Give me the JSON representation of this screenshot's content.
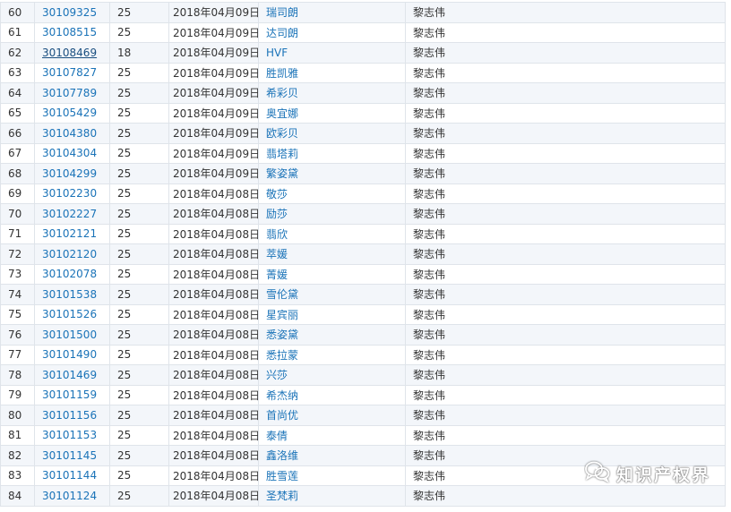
{
  "rows": [
    {
      "no": "60",
      "reg": "30109325",
      "cls": "25",
      "date": "2018年04月09日",
      "mark": "瑞司朗",
      "owner": "黎志伟"
    },
    {
      "no": "61",
      "reg": "30108515",
      "cls": "25",
      "date": "2018年04月09日",
      "mark": "达司朗",
      "owner": "黎志伟"
    },
    {
      "no": "62",
      "reg": "30108469",
      "cls": "18",
      "date": "2018年04月09日",
      "mark": "HVF",
      "owner": "黎志伟"
    },
    {
      "no": "63",
      "reg": "30107827",
      "cls": "25",
      "date": "2018年04月09日",
      "mark": "胜凯雅",
      "owner": "黎志伟"
    },
    {
      "no": "64",
      "reg": "30107789",
      "cls": "25",
      "date": "2018年04月09日",
      "mark": "希彩贝",
      "owner": "黎志伟"
    },
    {
      "no": "65",
      "reg": "30105429",
      "cls": "25",
      "date": "2018年04月09日",
      "mark": "奥宜娜",
      "owner": "黎志伟"
    },
    {
      "no": "66",
      "reg": "30104380",
      "cls": "25",
      "date": "2018年04月09日",
      "mark": "欧彩贝",
      "owner": "黎志伟"
    },
    {
      "no": "67",
      "reg": "30104304",
      "cls": "25",
      "date": "2018年04月09日",
      "mark": "翡塔莉",
      "owner": "黎志伟"
    },
    {
      "no": "68",
      "reg": "30104299",
      "cls": "25",
      "date": "2018年04月09日",
      "mark": "繁姿黛",
      "owner": "黎志伟"
    },
    {
      "no": "69",
      "reg": "30102230",
      "cls": "25",
      "date": "2018年04月08日",
      "mark": "敬莎",
      "owner": "黎志伟"
    },
    {
      "no": "70",
      "reg": "30102227",
      "cls": "25",
      "date": "2018年04月08日",
      "mark": "励莎",
      "owner": "黎志伟"
    },
    {
      "no": "71",
      "reg": "30102121",
      "cls": "25",
      "date": "2018年04月08日",
      "mark": "翡欣",
      "owner": "黎志伟"
    },
    {
      "no": "72",
      "reg": "30102120",
      "cls": "25",
      "date": "2018年04月08日",
      "mark": "萃媛",
      "owner": "黎志伟"
    },
    {
      "no": "73",
      "reg": "30102078",
      "cls": "25",
      "date": "2018年04月08日",
      "mark": "菁媛",
      "owner": "黎志伟"
    },
    {
      "no": "74",
      "reg": "30101538",
      "cls": "25",
      "date": "2018年04月08日",
      "mark": "雪伦黛",
      "owner": "黎志伟"
    },
    {
      "no": "75",
      "reg": "30101526",
      "cls": "25",
      "date": "2018年04月08日",
      "mark": "星宾丽",
      "owner": "黎志伟"
    },
    {
      "no": "76",
      "reg": "30101500",
      "cls": "25",
      "date": "2018年04月08日",
      "mark": "悉姿黛",
      "owner": "黎志伟"
    },
    {
      "no": "77",
      "reg": "30101490",
      "cls": "25",
      "date": "2018年04月08日",
      "mark": "悉拉蒙",
      "owner": "黎志伟"
    },
    {
      "no": "78",
      "reg": "30101469",
      "cls": "25",
      "date": "2018年04月08日",
      "mark": "兴莎",
      "owner": "黎志伟"
    },
    {
      "no": "79",
      "reg": "30101159",
      "cls": "25",
      "date": "2018年04月08日",
      "mark": "希杰纳",
      "owner": "黎志伟"
    },
    {
      "no": "80",
      "reg": "30101156",
      "cls": "25",
      "date": "2018年04月08日",
      "mark": "首尚优",
      "owner": "黎志伟"
    },
    {
      "no": "81",
      "reg": "30101153",
      "cls": "25",
      "date": "2018年04月08日",
      "mark": "泰倩",
      "owner": "黎志伟"
    },
    {
      "no": "82",
      "reg": "30101145",
      "cls": "25",
      "date": "2018年04月08日",
      "mark": "鑫洛维",
      "owner": "黎志伟"
    },
    {
      "no": "83",
      "reg": "30101144",
      "cls": "25",
      "date": "2018年04月08日",
      "mark": "胜雪莲",
      "owner": "黎志伟"
    },
    {
      "no": "84",
      "reg": "30101124",
      "cls": "25",
      "date": "2018年04月08日",
      "mark": "圣梵莉",
      "owner": "黎志伟"
    }
  ],
  "hovered_reg": "30108469",
  "watermark": {
    "text": "知识产权界",
    "icon": "wechat-icon"
  },
  "colors": {
    "link": "#1a73b8",
    "row_alt": "#f3f6fa",
    "border": "#dfe4ea"
  }
}
